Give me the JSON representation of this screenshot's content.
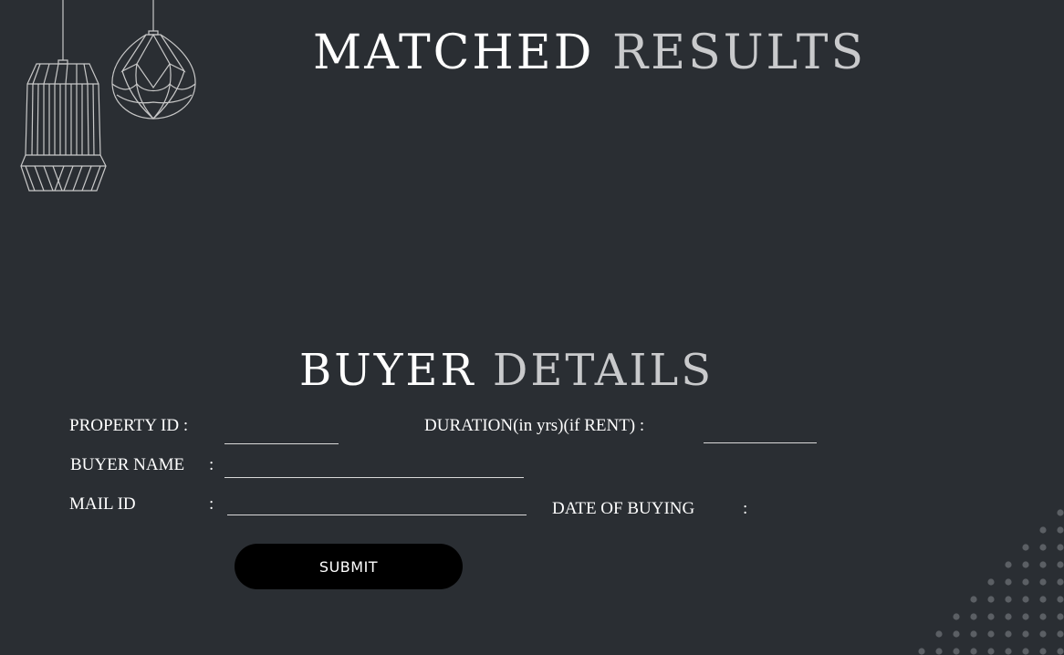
{
  "header": {
    "title_part1": "MATCHED",
    "title_part2": "RESULTS"
  },
  "form": {
    "title_part1": "BUYER",
    "title_part2": "DETAILS",
    "property_id_label": "PROPERTY ID :",
    "duration_label": "DURATION(in yrs)(if RENT) :",
    "buyer_name_label": "BUYER NAME",
    "buyer_name_colon": ":",
    "mail_id_label": "MAIL ID",
    "mail_id_colon": ":",
    "date_label": "DATE OF BUYING",
    "date_colon": ":",
    "property_id_value": "",
    "duration_value": "",
    "buyer_name_value": "",
    "mail_id_value": "",
    "submit_label": "SUBMIT"
  },
  "decor": {
    "icons": [
      "pendant-lamp-icon",
      "pendant-lamp-icon",
      "dot-pattern"
    ],
    "colors": {
      "background": "#2a2e33",
      "title_accent": "#c9cacc",
      "button": "#000000",
      "lamp_stroke": "#c8c8c8",
      "dots": "#5b5f64"
    }
  }
}
